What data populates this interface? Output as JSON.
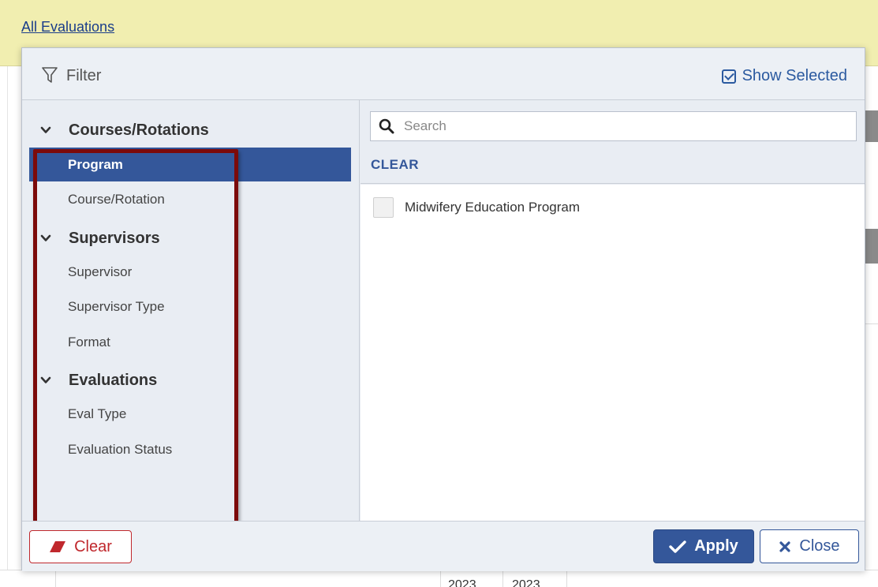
{
  "background": {
    "link_text": "All Evaluations",
    "years": [
      "2023",
      "2023"
    ]
  },
  "modal": {
    "title": "Filter",
    "show_selected_label": "Show Selected",
    "nav": {
      "groups": [
        {
          "label": "Courses/Rotations",
          "items": [
            "Program",
            "Course/Rotation"
          ]
        },
        {
          "label": "Supervisors",
          "items": [
            "Supervisor",
            "Supervisor Type",
            "Format"
          ]
        },
        {
          "label": "Evaluations",
          "items": [
            "Eval Type",
            "Evaluation Status"
          ]
        }
      ],
      "active_item": "Program"
    },
    "search": {
      "placeholder": "Search",
      "value": ""
    },
    "clear_link": "CLEAR",
    "options": [
      {
        "label": "Midwifery Education Program",
        "checked": false
      }
    ],
    "footer": {
      "clear_label": "Clear",
      "apply_label": "Apply",
      "close_label": "Close"
    }
  },
  "colors": {
    "header_bg": "#f1eeb0",
    "accent": "#34579a",
    "highlight_border": "#7c0a0a",
    "clear_red": "#c0282d"
  },
  "icons": [
    "filter-icon",
    "checkbox-checked-icon",
    "chevron-down-icon",
    "search-icon",
    "eraser-icon",
    "checkmark-icon",
    "close-x-icon"
  ]
}
